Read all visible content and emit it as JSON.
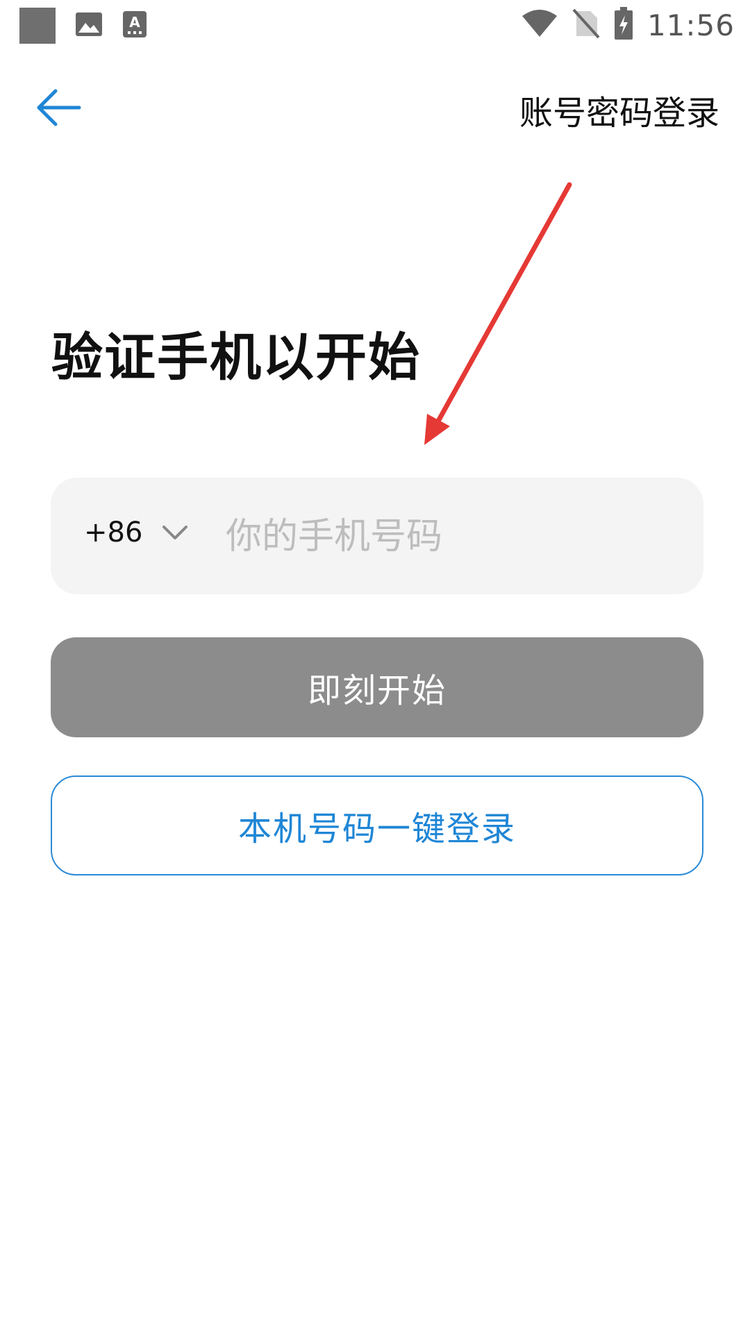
{
  "status_bar": {
    "time": "11:56",
    "left_icons": [
      "notification-square-icon",
      "gallery-icon",
      "keyboard-icon"
    ],
    "right_icons": [
      "wifi-icon",
      "no-sim-icon",
      "battery-charging-icon"
    ]
  },
  "header": {
    "back_icon": "arrow-left-icon",
    "account_login_label": "账号密码登录"
  },
  "title": "验证手机以开始",
  "phone": {
    "country_code": "+86",
    "country_code_icon": "chevron-down-icon",
    "placeholder": "你的手机号码"
  },
  "buttons": {
    "start_label": "即刻开始",
    "one_click_label": "本机号码一键登录"
  },
  "colors": {
    "accent": "#1f86d6",
    "start_button_bg": "#8c8c8c",
    "input_bg": "#f4f4f4",
    "annotation_arrow": "#e53935"
  }
}
